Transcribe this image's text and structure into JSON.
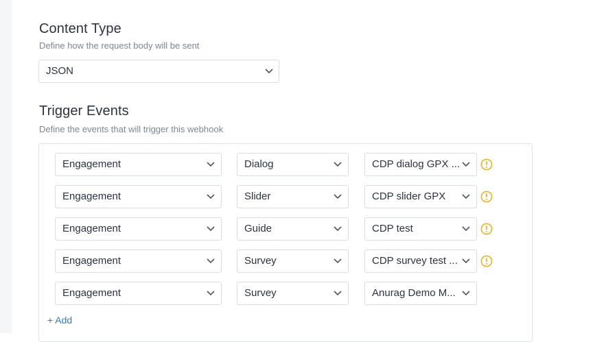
{
  "content_type": {
    "title": "Content Type",
    "description": "Define how the request body will be sent",
    "selected": "JSON"
  },
  "trigger_events": {
    "title": "Trigger Events",
    "description": "Define the events that will trigger this webhook",
    "rows": [
      {
        "category": "Engagement",
        "type": "Dialog",
        "item": "CDP dialog GPX ...",
        "warning": true
      },
      {
        "category": "Engagement",
        "type": "Slider",
        "item": "CDP slider GPX",
        "warning": true
      },
      {
        "category": "Engagement",
        "type": "Guide",
        "item": "CDP test",
        "warning": true
      },
      {
        "category": "Engagement",
        "type": "Survey",
        "item": "CDP survey test ...",
        "warning": true
      },
      {
        "category": "Engagement",
        "type": "Survey",
        "item": "Anurag Demo M...",
        "warning": false
      }
    ],
    "add_label": "+ Add"
  },
  "colors": {
    "accent": "#2d7fc2",
    "warning": "#e9b32a",
    "border": "#d9dde3"
  },
  "icons": {
    "dropdown": "chevron-down-icon",
    "warning": "warning-circle-icon"
  }
}
